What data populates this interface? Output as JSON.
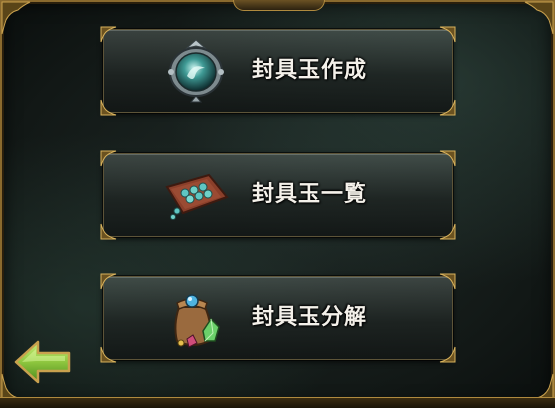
{
  "menu": {
    "items": [
      {
        "label": "封具玉作成",
        "icon": "jewel-orb-icon"
      },
      {
        "label": "封具玉一覧",
        "icon": "jewel-mat-icon"
      },
      {
        "label": "封具玉分解",
        "icon": "jewel-pouch-icon"
      }
    ]
  },
  "navigation": {
    "back_icon": "back-arrow-icon"
  },
  "colors": {
    "label_text": "#f4f1ea",
    "frame_gold": "#b08a3e",
    "back_arrow_green": "#8ec63f",
    "background": "#121816"
  }
}
